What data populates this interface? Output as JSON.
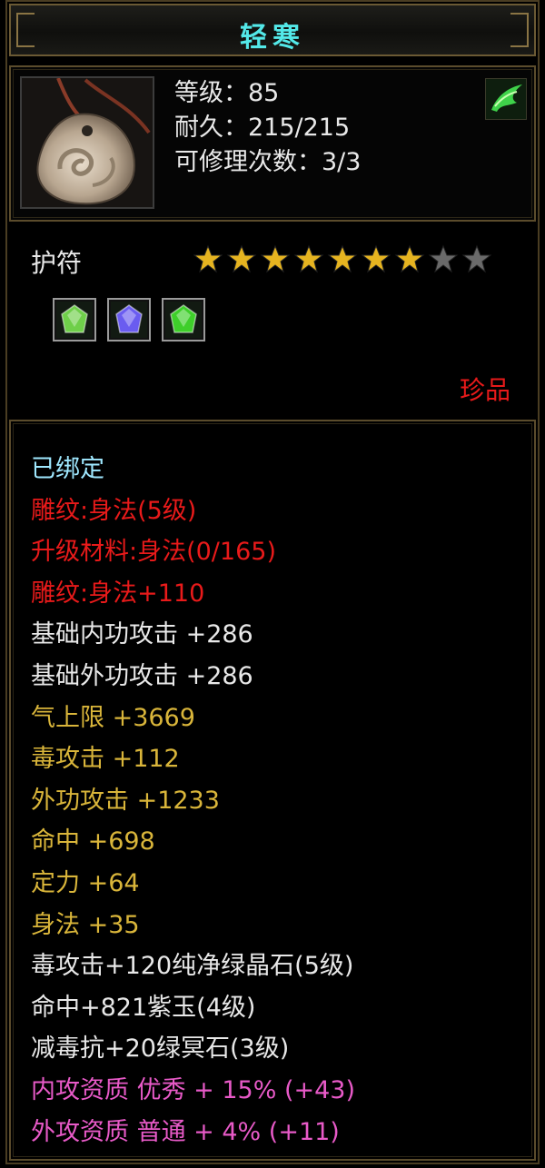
{
  "item": {
    "name": "轻寒",
    "level": "等级：85",
    "durability": "耐久：215/215",
    "repairs": "可修理次数：3/3",
    "type": "护符",
    "stars_filled": 7,
    "stars_total": 9,
    "quality": "珍品",
    "icon": "jade-pendant-icon",
    "corner_icon": "green-wind-gem-icon",
    "sockets": [
      {
        "icon": "green-diamond-gem-icon",
        "color": "#6fcf4a"
      },
      {
        "icon": "purple-jade-gem-icon",
        "color": "#6a5cf0"
      },
      {
        "icon": "green-crystal-gem-icon",
        "color": "#3ecf2a"
      }
    ]
  },
  "colors": {
    "title": "#53e8e8",
    "bound": "#9fe8ff",
    "engrave": "#e81a1a",
    "base": "#e8e8e8",
    "bonus": "#d9b53a",
    "aptitude": "#e85ac8",
    "quality": "#e81a1a",
    "star_on": "#e6b420",
    "star_off": "#6a6a6a"
  },
  "attributes": [
    {
      "text": "已绑定",
      "color": "#9fe8ff"
    },
    {
      "text": "雕纹:身法(5级)",
      "color": "#e81a1a"
    },
    {
      "text": "升级材料:身法(0/165)",
      "color": "#e81a1a"
    },
    {
      "text": "雕纹:身法+110",
      "color": "#e81a1a"
    },
    {
      "text": "基础内功攻击 +286",
      "color": "#e8e8e8"
    },
    {
      "text": "基础外功攻击 +286",
      "color": "#e8e8e8"
    },
    {
      "text": "气上限 +3669",
      "color": "#d9b53a"
    },
    {
      "text": "毒攻击 +112",
      "color": "#d9b53a"
    },
    {
      "text": "外功攻击 +1233",
      "color": "#d9b53a"
    },
    {
      "text": "命中 +698",
      "color": "#d9b53a"
    },
    {
      "text": "定力 +64",
      "color": "#d9b53a"
    },
    {
      "text": "身法 +35",
      "color": "#d9b53a"
    },
    {
      "text": "毒攻击+120纯净绿晶石(5级)",
      "color": "#e8e8e8"
    },
    {
      "text": "命中+821紫玉(4级)",
      "color": "#e8e8e8"
    },
    {
      "text": "减毒抗+20绿冥石(3级)",
      "color": "#e8e8e8"
    },
    {
      "text": "内攻资质 优秀 + 15% (+43)",
      "color": "#e85ac8"
    },
    {
      "text": "外攻资质 普通 + 4% (+11)",
      "color": "#e85ac8"
    }
  ]
}
